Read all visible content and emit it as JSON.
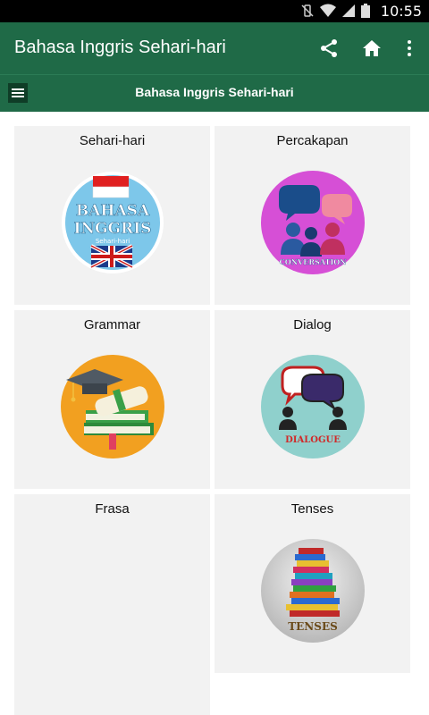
{
  "status": {
    "time": "10:55"
  },
  "appbar": {
    "title": "Bahasa Inggris Sehari-hari"
  },
  "subbar": {
    "title": "Bahasa Inggris Sehari-hari"
  },
  "cards": [
    {
      "label": "Sehari-hari",
      "icon": "bahasa-inggris-flag-icon",
      "icon_text": [
        "BAHASA",
        "INGGRIS",
        "Sehari-hari"
      ]
    },
    {
      "label": "Percakapan",
      "icon": "conversation-icon",
      "icon_text": "CONVERSATION"
    },
    {
      "label": "Grammar",
      "icon": "graduation-books-icon"
    },
    {
      "label": "Dialog",
      "icon": "dialogue-icon",
      "icon_text": "DIALOGUE"
    },
    {
      "label": "Frasa",
      "icon": ""
    },
    {
      "label": "Tenses",
      "icon": "stacked-books-icon",
      "icon_text": "TENSES"
    }
  ],
  "colors": {
    "primary": "#1f6a47",
    "card_bg": "#f2f2f2"
  }
}
